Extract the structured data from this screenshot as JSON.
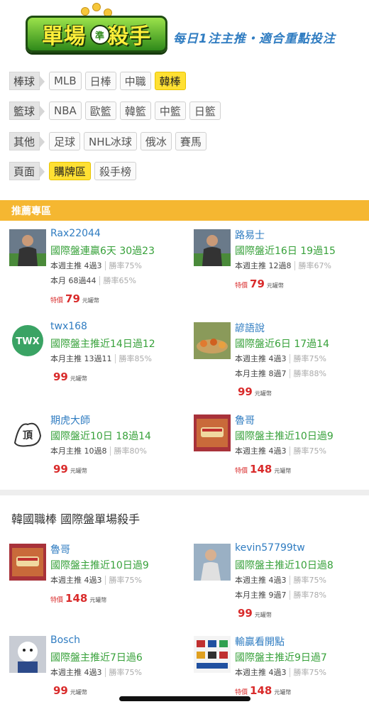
{
  "header": {
    "logo_text": "單場準殺手",
    "logo_left": "單場",
    "logo_seal": "準",
    "logo_right": "殺手",
    "tagline": "每日1注主推・適合重點投注"
  },
  "nav": {
    "rows": [
      {
        "category": "棒球",
        "tabs": [
          "MLB",
          "日棒",
          "中職",
          "韓棒"
        ],
        "active": 3
      },
      {
        "category": "籃球",
        "tabs": [
          "NBA",
          "歐籃",
          "韓籃",
          "中籃",
          "日籃"
        ],
        "active": -1
      },
      {
        "category": "其他",
        "tabs": [
          "足球",
          "NHL冰球",
          "俄冰",
          "賽馬"
        ],
        "active": -1
      },
      {
        "category": "頁面",
        "tabs": [
          "購牌區",
          "殺手榜"
        ],
        "active": 0
      }
    ]
  },
  "recommend_title": "推薦專區",
  "section2_title": "韓國職棒 國際盤單場殺手",
  "cards": [
    {
      "name": "Rax22044",
      "headline": "國際盤連贏6天 30過23",
      "stats": [
        {
          "label": "本週主推",
          "record": "4過3",
          "rate": "勝率75%"
        },
        {
          "label": "本月",
          "record": "68過44",
          "rate": "勝率65%"
        }
      ],
      "special": "特價",
      "price": "79",
      "unit": "元罐幣",
      "avatar": "player-photo"
    },
    {
      "name": "路易士",
      "headline": "國際盤近16日 19過15",
      "stats": [
        {
          "label": "本週主推",
          "record": "12過8",
          "rate": "勝率67%"
        }
      ],
      "special": "特價",
      "price": "79",
      "unit": "元罐幣",
      "avatar": "player-photo"
    },
    {
      "name": "twx168",
      "headline": "國際盤主推近14日過12",
      "stats": [
        {
          "label": "本月主推",
          "record": "13過11",
          "rate": "勝率85%"
        }
      ],
      "special": "",
      "price": "99",
      "unit": "元罐幣",
      "avatar": "twx-logo"
    },
    {
      "name": "諺語說",
      "headline": "國際盤近6日 17過14",
      "stats": [
        {
          "label": "本週主推",
          "record": "4過3",
          "rate": "勝率75%"
        },
        {
          "label": "本月主推",
          "record": "8過7",
          "rate": "勝率88%"
        }
      ],
      "special": "",
      "price": "99",
      "unit": "元罐幣",
      "avatar": "food-photo"
    },
    {
      "name": "期虎大師",
      "headline": "國際盤近10日 18過14",
      "stats": [
        {
          "label": "本月主推",
          "record": "10過8",
          "rate": "勝率80%"
        }
      ],
      "special": "",
      "price": "99",
      "unit": "元罐幣",
      "avatar": "drawing"
    },
    {
      "name": "魯哥",
      "headline": "國際盤主推近10日過9",
      "stats": [
        {
          "label": "本週主推",
          "record": "4過3",
          "rate": "勝率75%"
        }
      ],
      "special": "特價",
      "price": "148",
      "unit": "元罐幣",
      "avatar": "card-photo"
    },
    {
      "name": "魯哥",
      "headline": "國際盤主推近10日過9",
      "stats": [
        {
          "label": "本週主推",
          "record": "4過3",
          "rate": "勝率75%"
        }
      ],
      "special": "特價",
      "price": "148",
      "unit": "元罐幣",
      "avatar": "card-photo"
    },
    {
      "name": "kevin57799tw",
      "headline": "國際盤主推近10日過8",
      "stats": [
        {
          "label": "本週主推",
          "record": "4過3",
          "rate": "勝率75%"
        },
        {
          "label": "本月主推",
          "record": "9過7",
          "rate": "勝率78%"
        }
      ],
      "special": "",
      "price": "99",
      "unit": "元罐幣",
      "avatar": "person-photo"
    },
    {
      "name": "Bosch",
      "headline": "國際盤主推近7日過6",
      "stats": [
        {
          "label": "本週主推",
          "record": "4過3",
          "rate": "勝率75%"
        }
      ],
      "special": "",
      "price": "99",
      "unit": "元罐幣",
      "avatar": "mascot-photo"
    },
    {
      "name": "輸贏看開點",
      "headline": "國際盤主推近9日過7",
      "stats": [
        {
          "label": "本週主推",
          "record": "4過3",
          "rate": "勝率75%"
        }
      ],
      "special": "特價",
      "price": "148",
      "unit": "元罐幣",
      "avatar": "logos-photo"
    }
  ]
}
